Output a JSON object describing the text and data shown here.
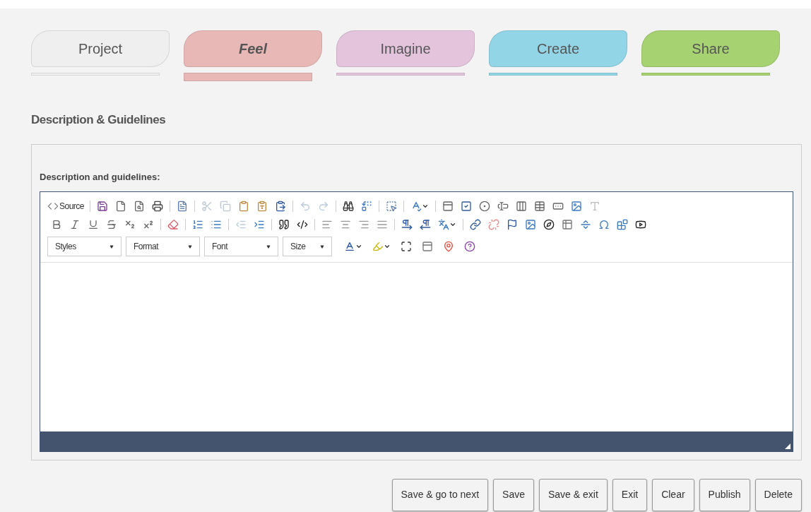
{
  "tabs": [
    {
      "label": "Project",
      "selected": false,
      "color": "#efefef"
    },
    {
      "label": "Feel",
      "selected": true,
      "color": "#e8b8b6"
    },
    {
      "label": "Imagine",
      "selected": false,
      "color": "#e4c4dd"
    },
    {
      "label": "Create",
      "selected": false,
      "color": "#92d5e6"
    },
    {
      "label": "Share",
      "selected": false,
      "color": "#a6d271"
    }
  ],
  "section_title": "Description & Guidelines",
  "field": {
    "label": "Description and guidelines:",
    "editor": {
      "source_button": "Source",
      "dropdowns": [
        "Styles",
        "Format",
        "Font",
        "Size"
      ]
    }
  },
  "buttons": [
    "Save & go to next",
    "Save",
    "Save & exit",
    "Exit",
    "Clear",
    "Publish",
    "Delete"
  ]
}
